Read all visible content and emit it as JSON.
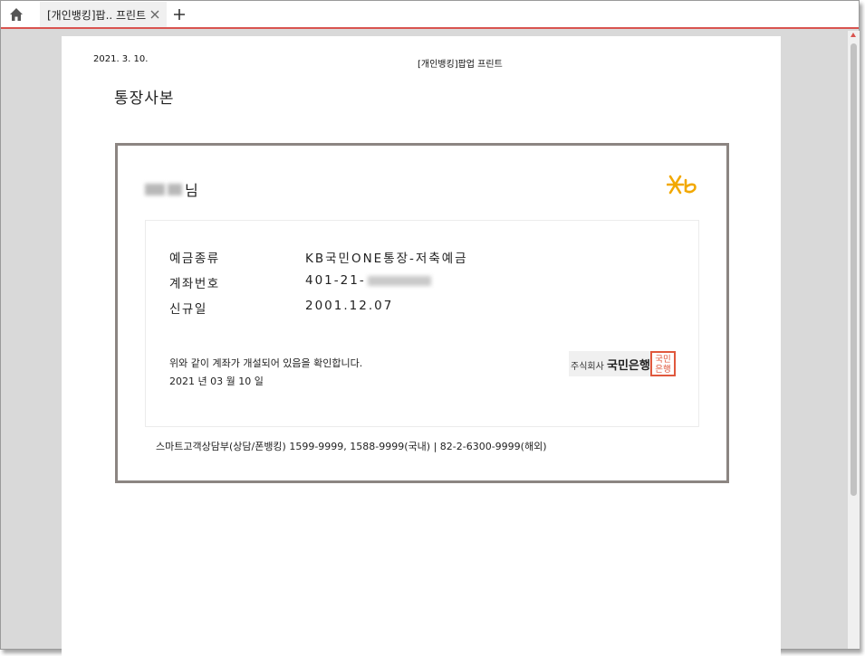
{
  "browser": {
    "tab_title": "[개인뱅킹]팝.. 프린트",
    "icons": {
      "home": "home-icon",
      "close": "close-icon",
      "new_tab": "plus-icon"
    }
  },
  "print_header": {
    "date": "2021. 3. 10.",
    "title": "[개인뱅킹]팝업 프린트"
  },
  "document": {
    "title": "통장사본",
    "holder_suffix": "님",
    "fields": [
      {
        "label": "예금종류",
        "value": "KB국민ONE통장-저축예금"
      },
      {
        "label": "계좌번호",
        "value": "401-21-"
      },
      {
        "label": "신규일",
        "value": "2001.12.07"
      }
    ],
    "confirm_text": "위와 같이 계좌가 개설되어 있음을 확인합니다.",
    "confirm_date": "2021 년 03 월 10 일",
    "bank_prefix": "주식회사",
    "bank_name": "국민은행",
    "seal_top": "국민",
    "seal_bottom": "은행",
    "footer": "스마트고객상담부(상담/폰뱅킹) 1599-9999, 1588-9999(국내) | 82-2-6300-9999(해외)"
  },
  "colors": {
    "accent_red": "#d9534f",
    "kb_yellow": "#f2a800",
    "seal_red": "#e0583d",
    "certificate_border": "#8c8582"
  }
}
